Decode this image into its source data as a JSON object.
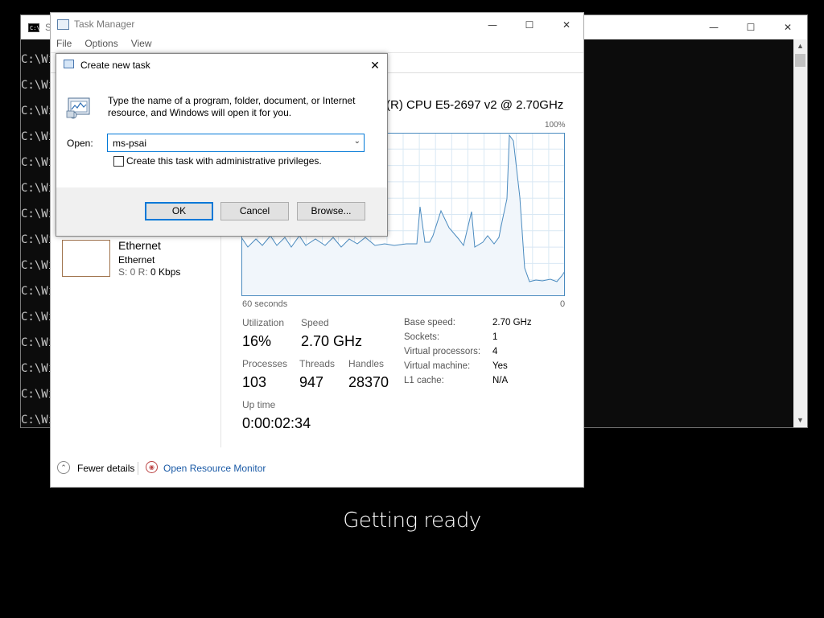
{
  "console": {
    "title": "S",
    "icon_text": "C:\\",
    "lines": [
      "C:\\Wi",
      "C:\\Wi",
      "C:\\Wi",
      "C:\\Wi",
      "C:\\Wi",
      "C:\\Wi",
      "C:\\Wi",
      "C:\\Wi",
      "C:\\Wi",
      "C:\\Wi",
      "C:\\Wi",
      "C:\\Wi",
      "C:\\Wi",
      "C:\\Wi",
      "C:\\Wi"
    ]
  },
  "task_manager": {
    "title": "Task Manager",
    "menu": [
      "File",
      "Options",
      "View"
    ],
    "cpu_name": "(R) CPU E5-2697 v2 @ 2.70GHz",
    "graph": {
      "top_label": "100%",
      "left_label": "60 seconds",
      "right_label": "0",
      "line_color": "#4b8bbf",
      "fill_color": "#f1f6fb",
      "grid_color": "#d9e8f4"
    },
    "ethernet": {
      "title": "Ethernet",
      "subtitle": "Ethernet",
      "speed_prefix": "S: 0 R: ",
      "speed_value": "0 Kbps"
    },
    "stats": {
      "utilization_label": "Utilization",
      "utilization_value": "16%",
      "speed_label": "Speed",
      "speed_value": "2.70 GHz",
      "processes_label": "Processes",
      "processes_value": "103",
      "threads_label": "Threads",
      "threads_value": "947",
      "handles_label": "Handles",
      "handles_value": "28370",
      "uptime_label": "Up time",
      "uptime_value": "0:00:02:34"
    },
    "specs": [
      {
        "label": "Base speed:",
        "value": "2.70 GHz"
      },
      {
        "label": "Sockets:",
        "value": "1"
      },
      {
        "label": "Virtual processors:",
        "value": "4"
      },
      {
        "label": "Virtual machine:",
        "value": "Yes"
      },
      {
        "label": "L1 cache:",
        "value": "N/A"
      }
    ],
    "footer": {
      "fewer_details": "Fewer details",
      "open_resource_monitor": "Open Resource Monitor"
    }
  },
  "dialog": {
    "title": "Create new task",
    "description": "Type the name of a program, folder, document, or Internet resource, and Windows will open it for you.",
    "open_label": "Open:",
    "open_value": "ms-psai",
    "admin_checkbox_label": "Create this task with administrative privileges.",
    "admin_checked": false,
    "ok_label": "OK",
    "cancel_label": "Cancel",
    "browse_label": "Browse..."
  },
  "status_text": "Getting ready"
}
